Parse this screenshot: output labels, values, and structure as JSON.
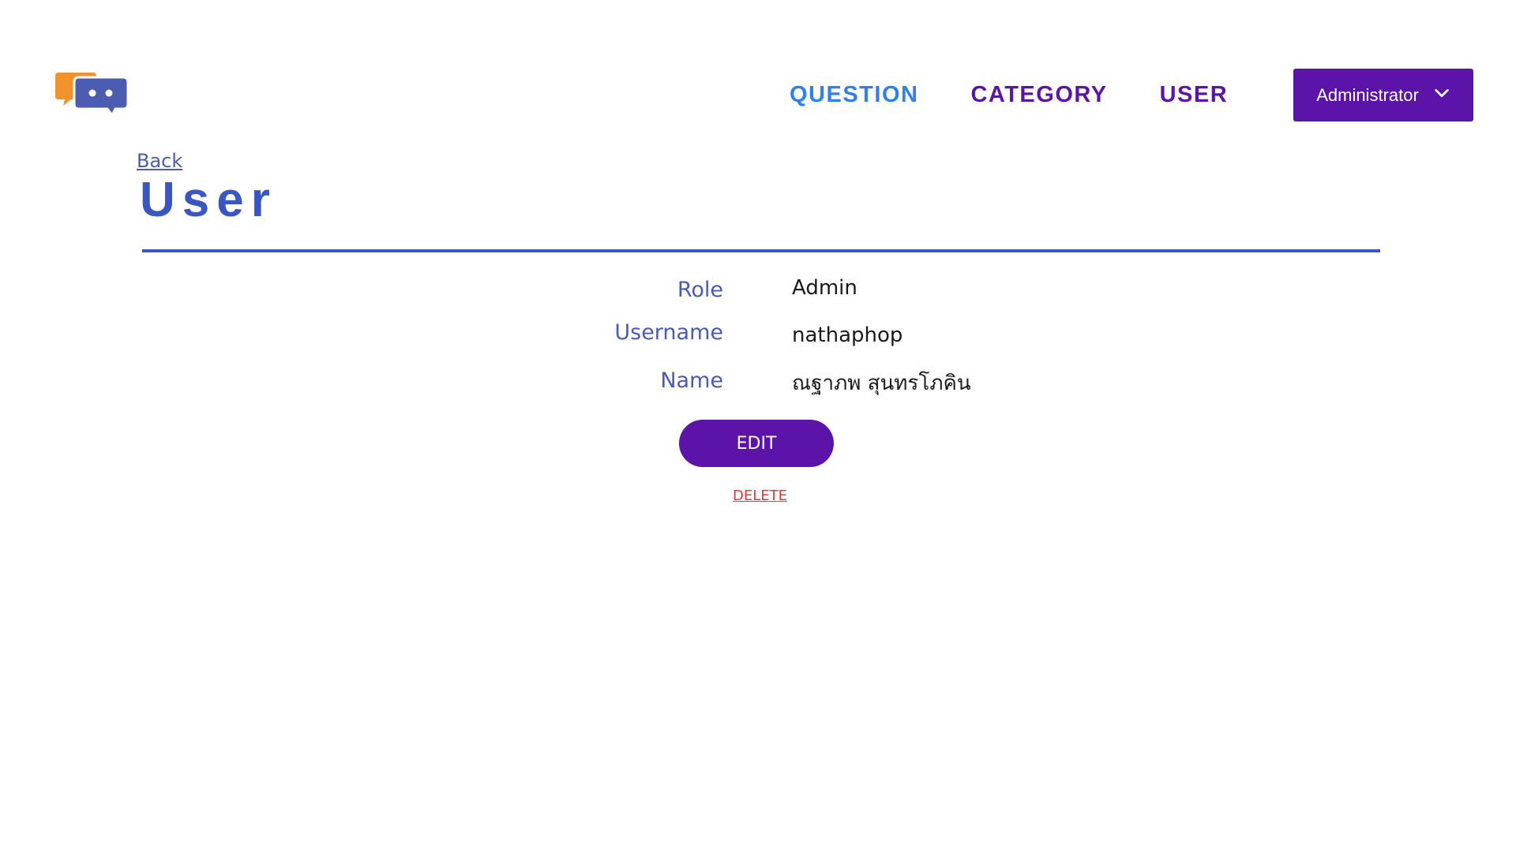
{
  "colors": {
    "primary_purple": "#5b13a8",
    "nav_blue": "#2f80ed",
    "title_blue": "#3a56c2",
    "label_blue": "#4a5bb0",
    "link_blue": "#4a5bb0",
    "delete_red": "#e53935",
    "logo_orange": "#f0932b",
    "logo_blue": "#4a5bb0"
  },
  "header": {
    "logo_icon": "chat-bubbles-logo-icon",
    "nav": [
      {
        "label": "QUESTION",
        "color": "#2f80ed"
      },
      {
        "label": "CATEGORY",
        "color": "#5b13a8"
      },
      {
        "label": "USER",
        "color": "#5b13a8"
      }
    ],
    "account_menu": {
      "label": "Administrator",
      "icon": "chevron-down-icon"
    }
  },
  "main": {
    "back_label": "Back",
    "title": "User",
    "details": [
      {
        "label": "Role",
        "value": "Admin"
      },
      {
        "label": "Username",
        "value": "nathaphop"
      },
      {
        "label": "Name",
        "value": "ณฐาภพ สุนทรโภคิน"
      }
    ],
    "edit_label": "EDIT",
    "delete_label": "DELETE"
  }
}
